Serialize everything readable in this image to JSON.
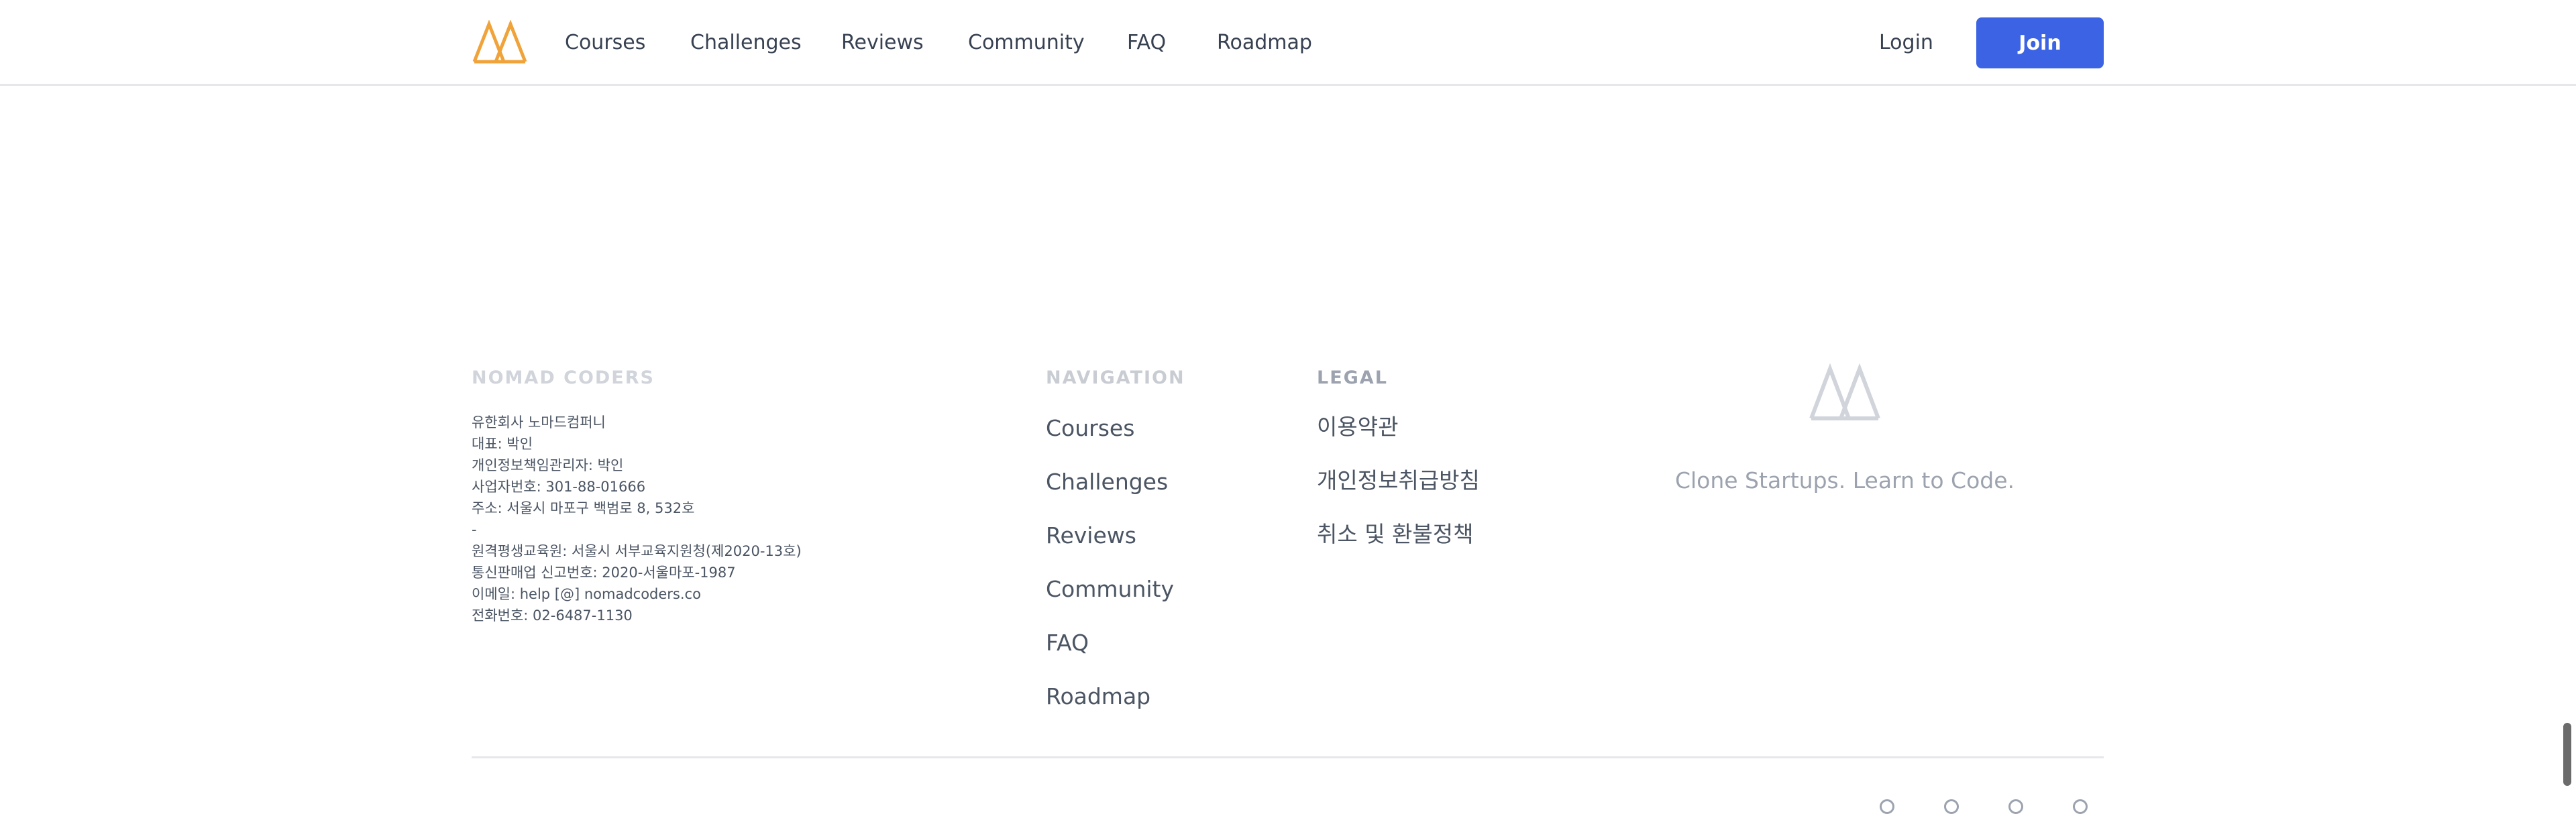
{
  "header": {
    "nav": [
      {
        "label": "Courses"
      },
      {
        "label": "Challenges"
      },
      {
        "label": "Reviews"
      },
      {
        "label": "Community"
      },
      {
        "label": "FAQ"
      },
      {
        "label": "Roadmap"
      }
    ],
    "login_label": "Login",
    "join_label": "Join",
    "logo_icon": "nomad-logo-icon",
    "logo_color": "#f0a33a",
    "join_color": "#3b63e3"
  },
  "footer": {
    "company": {
      "heading": "NOMAD CODERS",
      "lines": [
        "유한회사 노마드컴퍼니",
        "대표: 박인",
        "개인정보책임관리자: 박인",
        "사업자번호: 301-88-01666",
        "주소: 서울시 마포구 백범로 8, 532호",
        "-",
        "원격평생교육원: 서울시 서부교육지원청(제2020-13호)",
        "통신판매업 신고번호: 2020-서울마포-1987",
        "이메일: help [@] nomadcoders.co",
        "전화번호: 02-6487-1130"
      ]
    },
    "navigation": {
      "heading": "NAVIGATION",
      "links": [
        "Courses",
        "Challenges",
        "Reviews",
        "Community",
        "FAQ",
        "Roadmap"
      ]
    },
    "legal": {
      "heading": "LEGAL",
      "links": [
        "이용약관",
        "개인정보취급방침",
        "취소 및 환불정책"
      ]
    },
    "brand": {
      "logo_icon": "nomad-logo-icon",
      "tagline": "Clone Startups. Learn to Code."
    }
  }
}
